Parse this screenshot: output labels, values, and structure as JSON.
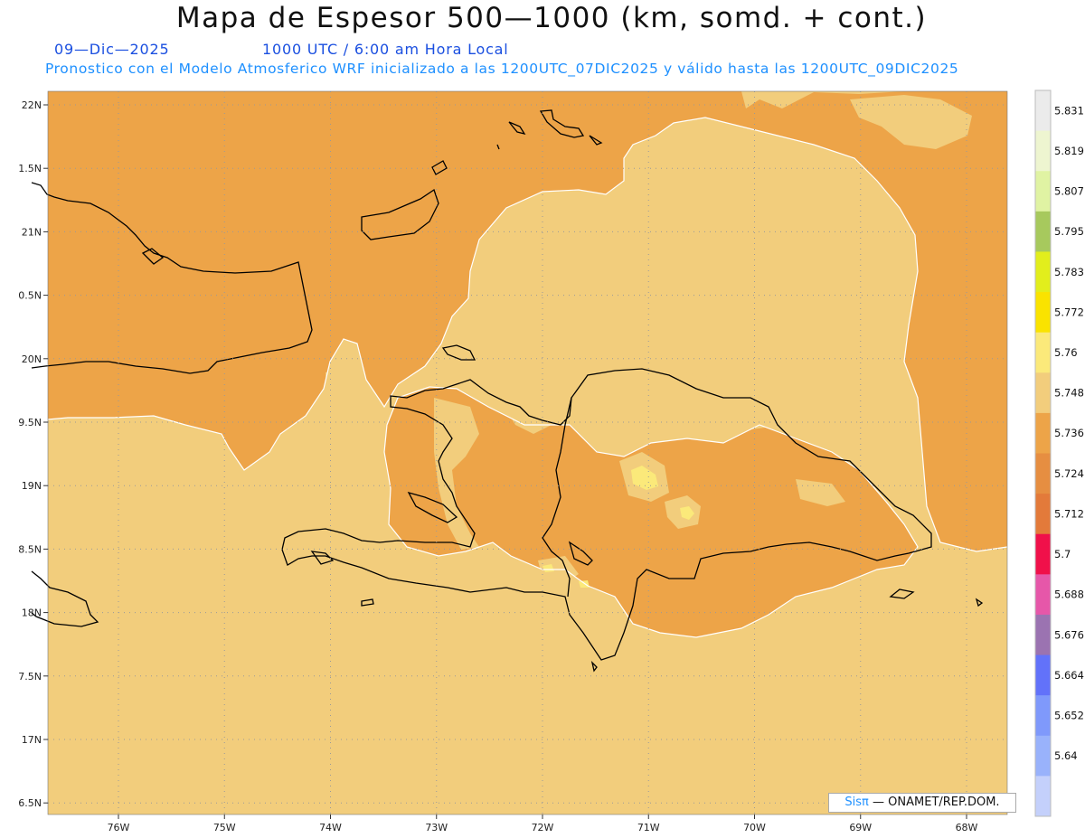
{
  "title": "Mapa de Espesor 500—1000 (km, somd. + cont.)",
  "date_text": "09—Dic—2025",
  "utc_text": "1000 UTC / 6:00 am Hora Local",
  "info_text": "Pronostico con el Modelo Atmosferico WRF inicializado a las 1200UTC_07DIC2025 y válido hasta las  1200UTC_09DIC2025",
  "credit": {
    "sis": "Sisπ",
    "rest": "— ONAMET/REP.DOM."
  },
  "axes": {
    "lon_ticks": [
      "76W",
      "75W",
      "74W",
      "73W",
      "72W",
      "71W",
      "70W",
      "69W",
      "68W"
    ],
    "lat_ticks": [
      "22N",
      "1.5N",
      "21N",
      "0.5N",
      "20N",
      "9.5N",
      "19N",
      "8.5N",
      "18N",
      "7.5N",
      "17N",
      "6.5N"
    ]
  },
  "legend": {
    "levels": [
      "5.64",
      "5.652",
      "5.664",
      "5.676",
      "5.688",
      "5.7",
      "5.712",
      "5.724",
      "5.736",
      "5.748",
      "5.76",
      "5.772",
      "5.783",
      "5.795",
      "5.807",
      "5.819",
      "5.831"
    ],
    "colors": [
      "#c4d0fb",
      "#99b2fb",
      "#7f99fb",
      "#6272fa",
      "#9b73b1",
      "#e657a9",
      "#f0104a",
      "#e37a3a",
      "#e68e41",
      "#eda448",
      "#f2cd7c",
      "#fbe97a",
      "#fae300",
      "#e2ee1c",
      "#a7c95d",
      "#e0f3a3",
      "#eef5d0",
      "#ebebeb"
    ]
  },
  "colors": {
    "background_field": "#f2cd7c",
    "field_dark": "#eda448",
    "field_darker": "#e68e41",
    "field_yellow": "#fbe97a",
    "coast": "#000000",
    "contour": "#ffffff"
  }
}
